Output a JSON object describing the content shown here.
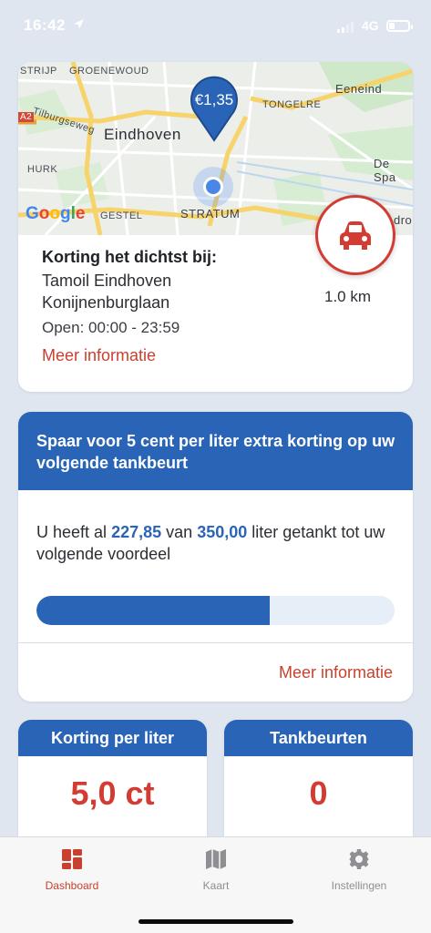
{
  "status_bar": {
    "time": "16:42",
    "network": "4G"
  },
  "map": {
    "labels": {
      "strijp": "STRIJP",
      "groenewoud": "GROENEWOUD",
      "eeneind": "Eeneind",
      "tilburgseweg": "Tilburgseweg",
      "tongelre": "TONGELRE",
      "eindhoven": "Eindhoven",
      "a2": "A2",
      "hurk": "HURK",
      "de_spa": "De Spa",
      "gestel": "GESTEL",
      "stratum": "STRATUM",
      "drop": "drop"
    },
    "google_letters": [
      "G",
      "o",
      "o",
      "g",
      "l",
      "e"
    ],
    "price_pin": "€1,35"
  },
  "nearest": {
    "title": "Korting het dichtst bij:",
    "name": "Tamoil Eindhoven",
    "street": "Konijnenburglaan",
    "hours": "Open: 00:00 - 23:59",
    "more_info": "Meer informatie",
    "distance": "1.0 km"
  },
  "savings": {
    "title": "Spaar voor 5 cent per liter extra korting op uw volgende tankbeurt",
    "text_prefix": "U heeft al",
    "current": "227,85",
    "text_mid": "van",
    "target": "350,00",
    "text_suffix": "liter getankt tot uw volgende voordeel",
    "progress": 0.651,
    "more_info": "Meer informatie"
  },
  "stats": {
    "discount_title": "Korting per liter",
    "discount_value": "5,0 ct",
    "fills_title": "Tankbeurten",
    "fills_value": "0"
  },
  "tabs": [
    {
      "label": "Dashboard",
      "icon": "dashboard-icon",
      "active": true
    },
    {
      "label": "Kaart",
      "icon": "map-icon",
      "active": false
    },
    {
      "label": "Instellingen",
      "icon": "gear-icon",
      "active": false
    }
  ],
  "colors": {
    "primary_blue": "#2a64b6",
    "accent_red": "#d23c33",
    "link_red": "#c8412f",
    "background": "#dfe6f0"
  }
}
